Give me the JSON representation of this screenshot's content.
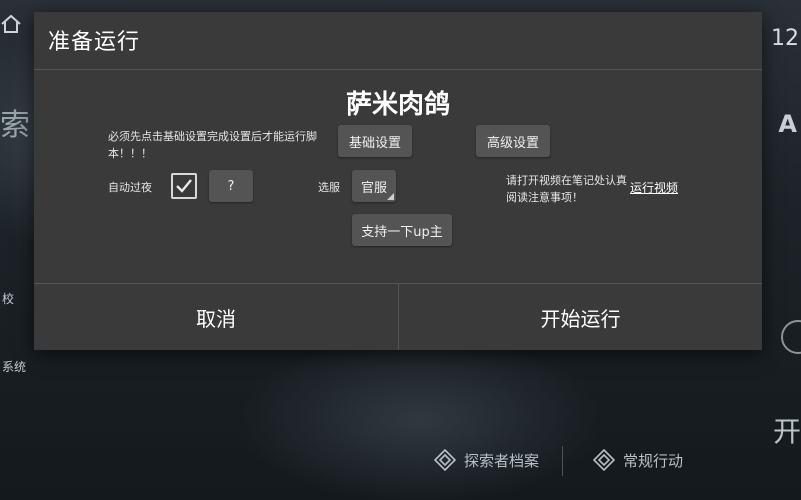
{
  "background": {
    "left_char": "索",
    "left_label_top": "校",
    "left_label_bottom": "系统",
    "top_right_text": "12",
    "right_letter": "A",
    "nav_items": [
      {
        "label": "探索者档案",
        "icon": "diamond-icon"
      },
      {
        "label": "常规行动",
        "icon": "diamond-icon"
      }
    ],
    "right_bottom_char": "开"
  },
  "dialog": {
    "title": "准备运行",
    "script_name": "萨米肉鸽",
    "notice": "必须先点击基础设置完成设置后才能运行脚本！！！",
    "basic_settings_label": "基础设置",
    "advanced_settings_label": "高级设置",
    "auto_pass_label": "自动过夜",
    "auto_pass_checked": true,
    "help_button_label": "?",
    "server_label": "选服",
    "server_value": "官服",
    "support_label": "支持一下up主",
    "video_notice": "请打开视频在笔记处认真阅读注意事项！",
    "run_video_link": "运行视频",
    "cancel_label": "取消",
    "start_label": "开始运行"
  },
  "colors": {
    "dialog_bg": "#3a3a3a",
    "button_bg": "#545454",
    "text": "#ffffff"
  }
}
